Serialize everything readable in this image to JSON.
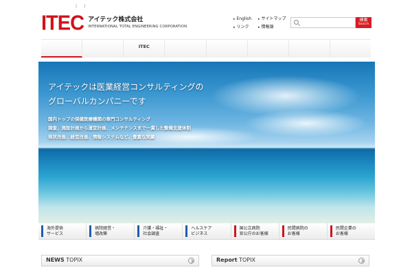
{
  "topnote": "( )",
  "logo": {
    "mark": "ITEC",
    "jp": "アイテック株式会社",
    "en": "INTERNATIONAL TOTAL ENGINEERING CORPORATION",
    "brand_color": "#d0121b"
  },
  "toplinks": [
    {
      "label": "English"
    },
    {
      "label": "サイトマップ"
    },
    {
      "label": "リンク"
    },
    {
      "label": "情報源"
    }
  ],
  "search": {
    "placeholder": "",
    "button_jp": "検索",
    "button_en": "Search"
  },
  "nav": {
    "items": [
      "",
      "",
      "ITEC",
      "",
      "",
      "",
      "",
      ""
    ],
    "active_index": 0
  },
  "hero": {
    "title_line1": "アイテックは医業経営コンサルティングの",
    "title_line2": "グローバルカンパニーです",
    "copy": [
      "国内トップの保健医療機関の専門コンサルティング",
      "調査、施設計画から運営計画、メンテナンスまで一貫した整備支援体制",
      "現状改善、経営改善、情報システムなど、豊富な実績"
    ]
  },
  "services": [
    {
      "label": "海外提供\nサービス",
      "color": "#1a5fa8"
    },
    {
      "label": "病院経営・\n増改築",
      "color": "#1a5fa8"
    },
    {
      "label": "介護・福祉・\n社会調査",
      "color": "#1a5fa8"
    },
    {
      "label": "ヘルスケア\nビジネス",
      "color": "#1a5fa8"
    },
    {
      "label": "国公立病院\n官公庁のお客様",
      "color": "#c9161d"
    },
    {
      "label": "民間病院の\nお客様",
      "color": "#c9161d"
    },
    {
      "label": "民間企業の\nお客様",
      "color": "#c9161d"
    }
  ],
  "topix": {
    "news_bold": "NEWS",
    "news_rest": " TOPIX",
    "report_bold": "Report",
    "report_rest": " TOPIX"
  }
}
